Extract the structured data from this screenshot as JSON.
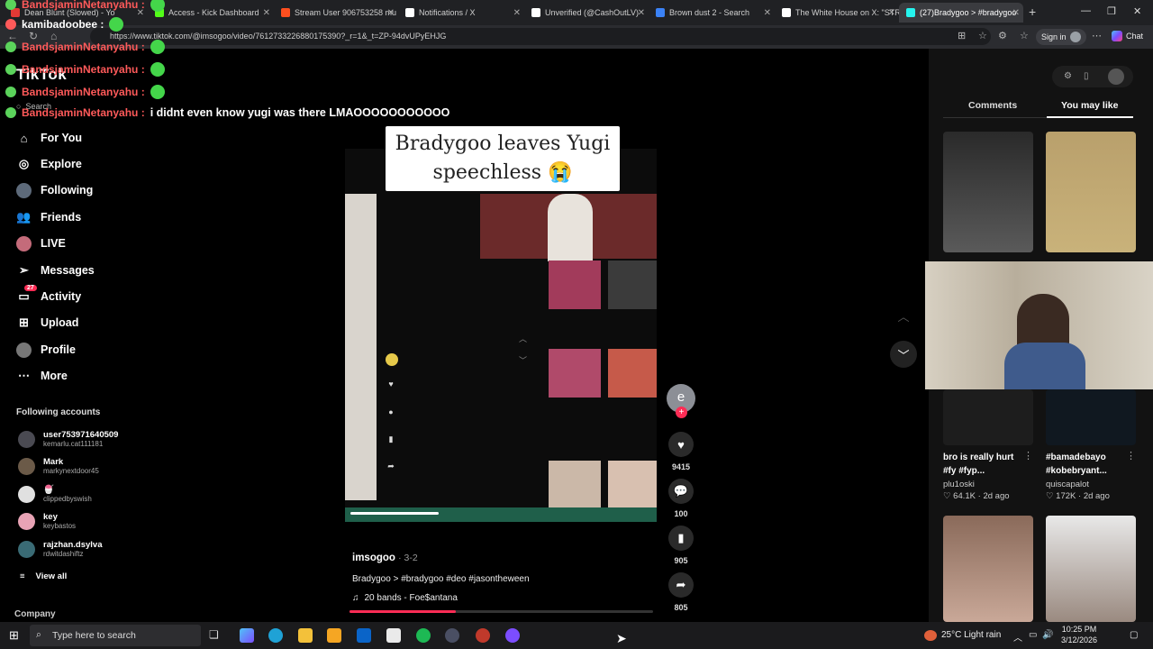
{
  "browser": {
    "tabs": [
      {
        "title": "Dean Blunt (Slowed) - Yo",
        "fav": "#e53935"
      },
      {
        "title": "Access - Kick Dashboard",
        "fav": "#53fc18"
      },
      {
        "title": "Stream User 906753258 mu",
        "fav": "#ff4f1f"
      },
      {
        "title": "Notifications / X",
        "fav": "#ffffff"
      },
      {
        "title": "Unverified (@CashOutLV)",
        "fav": "#ffffff"
      },
      {
        "title": "Brown dust 2 - Search",
        "fav": "#3b82f6"
      },
      {
        "title": "The White House on X: \"STR",
        "fav": "#ffffff"
      },
      {
        "title": "(27)Bradygoo > #bradygoo",
        "fav": "#25f4ee"
      }
    ],
    "url": "https://www.tiktok.com/@imsogoo/video/7612733226880175390?_r=1&_t=ZP-94dvUPyEHJG",
    "signin_label": "Sign in",
    "chat_label": "Chat"
  },
  "chat": [
    {
      "name": "BandsjaminNetanyahu :",
      "message": "",
      "name_color": "red"
    },
    {
      "name": "kamibadoobee :",
      "message": "",
      "name_color": "white"
    },
    {
      "name": "BandsjaminNetanyahu :",
      "message": "",
      "name_color": "red"
    },
    {
      "name": "BandsjaminNetanyahu :",
      "message": "",
      "name_color": "red"
    },
    {
      "name": "BandsjaminNetanyahu :",
      "message": "",
      "name_color": "red"
    },
    {
      "name": "BandsjaminNetanyahu :",
      "message": "i didnt even know yugi was there LMAOOOOOOOOOOO",
      "name_color": "red"
    }
  ],
  "sidebar": {
    "logo": "TikTok",
    "search_label": "Search",
    "nav": [
      {
        "label": "For You",
        "icon": "home-icon"
      },
      {
        "label": "Explore",
        "icon": "compass-icon"
      },
      {
        "label": "Following",
        "icon": "following-avatar-icon"
      },
      {
        "label": "Friends",
        "icon": "friends-icon"
      },
      {
        "label": "LIVE",
        "icon": "live-icon"
      },
      {
        "label": "Messages",
        "icon": "paper-plane-icon"
      },
      {
        "label": "Activity",
        "icon": "inbox-icon",
        "badge": "27"
      },
      {
        "label": "Upload",
        "icon": "plus-square-icon"
      },
      {
        "label": "Profile",
        "icon": "profile-avatar-icon"
      },
      {
        "label": "More",
        "icon": "more-dots-icon"
      }
    ],
    "following_title": "Following accounts",
    "accounts": [
      {
        "name": "user753971640509",
        "handle": "kemarlu.cat111181",
        "color": "#4a4a52"
      },
      {
        "name": "Mark",
        "handle": "markynextdoor45",
        "color": "#6b5a48"
      },
      {
        "name": "🍧",
        "handle": "clippedbyswish",
        "color": "#e0e0e0"
      },
      {
        "name": "key",
        "handle": "keybastos",
        "color": "#e8a3b5"
      },
      {
        "name": "rajzhan.dsylva",
        "handle": "rdwitdashiftz",
        "color": "#3a6b75"
      }
    ],
    "view_all": "View all",
    "company": "Company"
  },
  "video": {
    "overlay_title_line1": "Bradygoo leaves Yugi",
    "overlay_title_line2": "speechless 😭",
    "author": "imsogoo",
    "date": "· 3-2",
    "description": "Bradygoo > #bradygoo #deo #jasontheween",
    "music": "20 bands - Foe$antana",
    "progress": 0.35,
    "avatar_letter": "e",
    "likes": "9415",
    "comments": "100",
    "saves": "905",
    "shares": "805"
  },
  "right_panel": {
    "tabs": [
      "Comments",
      "You may like"
    ],
    "active_tab": "You may like",
    "cards": [
      {
        "title": "bro is really hurt #fy #fyp...",
        "user": "plu1oski",
        "likes": "64.1K",
        "age": "2d ago"
      },
      {
        "title": "#bamadebayo #kobebryant...",
        "user": "quiscapalot",
        "likes": "172K",
        "age": "2d ago"
      }
    ]
  },
  "taskbar": {
    "search_placeholder": "Type here to search",
    "weather": "25°C  Light rain",
    "time": "10:25 PM",
    "date": "3/12/2026"
  }
}
